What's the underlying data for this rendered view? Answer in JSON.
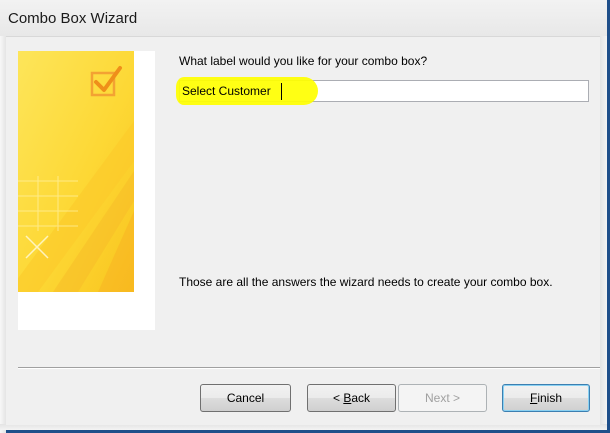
{
  "window": {
    "title": "Combo Box Wizard"
  },
  "wizard": {
    "prompt": "What label would you like for your combo box?",
    "label_input": {
      "value": "Select Customer"
    },
    "footer_text": "Those are all the answers the wizard needs to create your combo box.",
    "buttons": {
      "cancel": "Cancel",
      "back_prefix": "< ",
      "back_accel": "B",
      "back_rest": "ack",
      "next": "Next >",
      "finish_accel": "F",
      "finish_rest": "inish"
    }
  },
  "colors": {
    "illustration_primary": "#fdd835",
    "illustration_accent": "#f5a623",
    "annotation_highlight": "#ffff00",
    "selection": "#3399ff",
    "window_frame": "#1f4f8a"
  },
  "icons": {
    "illustration": "wizard-checkmark-illustration"
  }
}
